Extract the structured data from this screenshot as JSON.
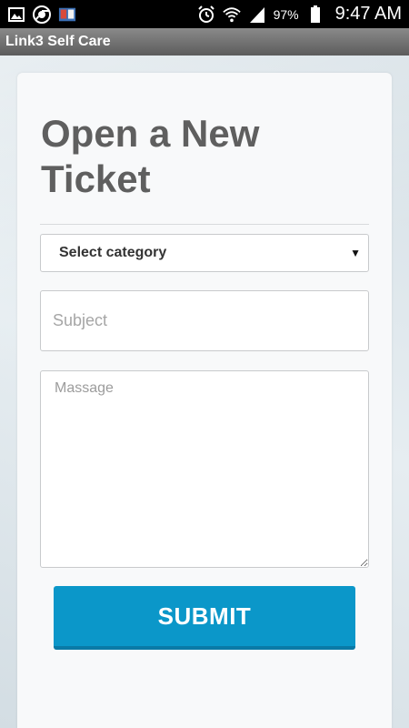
{
  "status_bar": {
    "battery_percent": "97%",
    "time": "9:47 AM",
    "icons_left": [
      "gallery-icon",
      "chrome-icon",
      "book-app-icon"
    ],
    "icons_right": [
      "alarm-icon",
      "wifi-icon",
      "signal-icon",
      "battery-icon"
    ]
  },
  "app_bar": {
    "title": "Link3 Self Care"
  },
  "form": {
    "title": "Open a New Ticket",
    "category_select": {
      "selected": "Select category"
    },
    "subject": {
      "placeholder": "Subject",
      "value": ""
    },
    "message": {
      "placeholder": "Massage",
      "value": ""
    },
    "submit_label": "SUBMIT"
  },
  "colors": {
    "accent": "#0b97c9",
    "title_text": "#5f5f5f",
    "app_bar": "#777777"
  }
}
